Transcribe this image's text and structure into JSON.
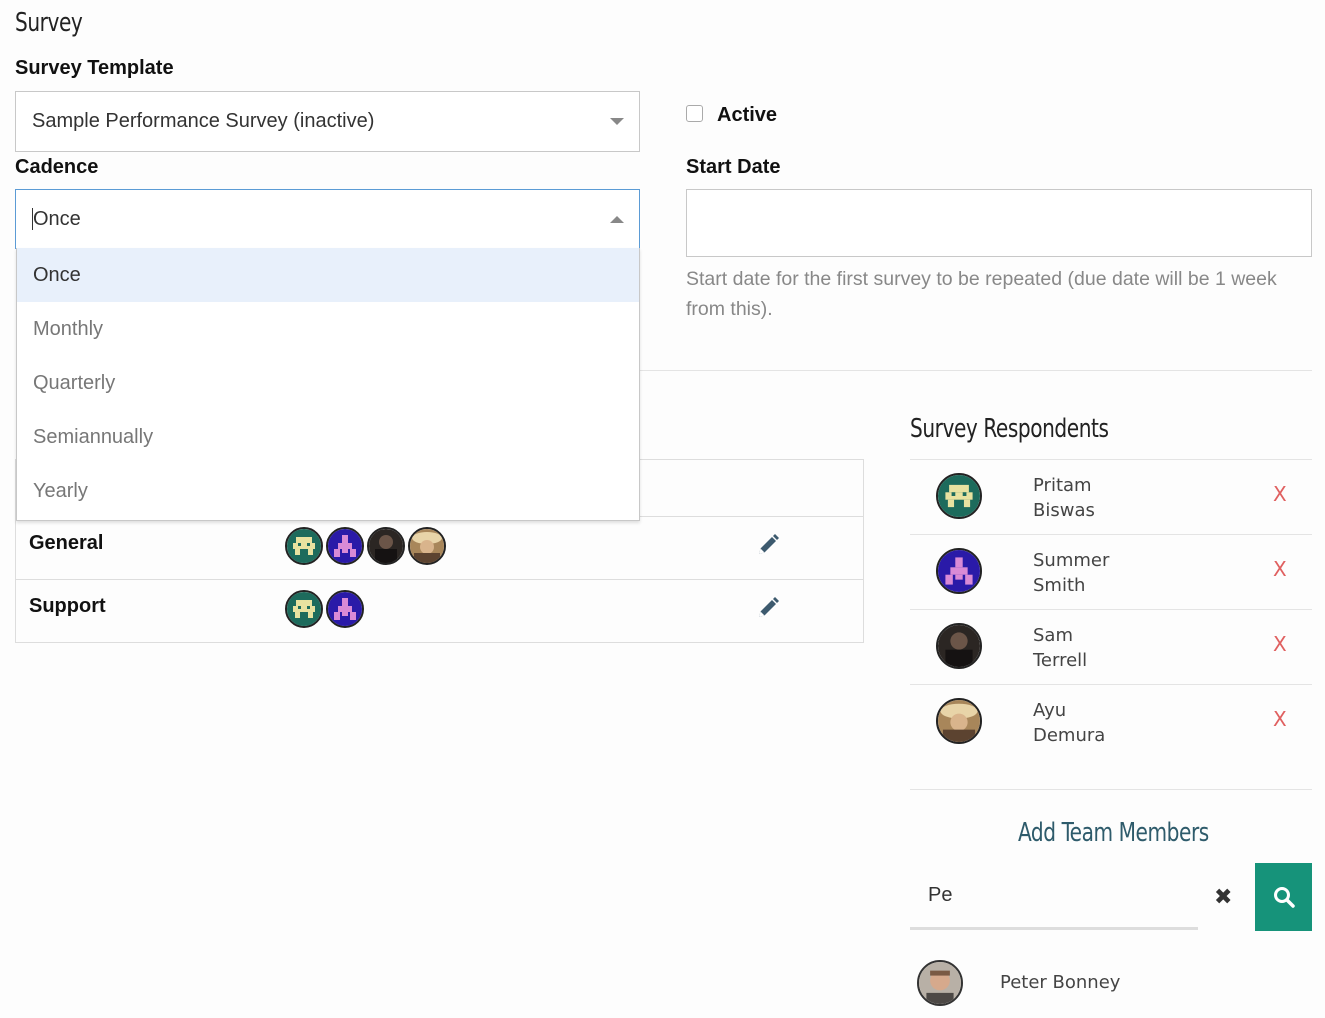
{
  "page": {
    "title": "Survey"
  },
  "survey_template": {
    "label": "Survey Template",
    "selected": "Sample Performance Survey (inactive)"
  },
  "active": {
    "label": "Active",
    "checked": false
  },
  "cadence": {
    "label": "Cadence",
    "selected": "Once",
    "options": [
      "Once",
      "Monthly",
      "Quarterly",
      "Semiannually",
      "Yearly"
    ]
  },
  "start_date": {
    "label": "Start Date",
    "value": "",
    "help": "Start date for the first survey to be repeated (due date will be 1 week from this)."
  },
  "teams": [
    {
      "name": "General",
      "avatars": [
        "pixel-teal",
        "pixel-purple",
        "photo-dark",
        "photo-tan"
      ]
    },
    {
      "name": "Support",
      "avatars": [
        "pixel-teal",
        "pixel-purple"
      ]
    }
  ],
  "respondents": {
    "title": "Survey Respondents",
    "items": [
      {
        "first": "Pritam",
        "last": "Biswas",
        "avatar": "pixel-teal",
        "remove": "X"
      },
      {
        "first": "Summer",
        "last": "Smith",
        "avatar": "pixel-purple",
        "remove": "X"
      },
      {
        "first": "Sam",
        "last": "Terrell",
        "avatar": "photo-dark",
        "remove": "X"
      },
      {
        "first": "Ayu",
        "last": "Demura",
        "avatar": "photo-tan",
        "remove": "X"
      }
    ]
  },
  "add_members": {
    "title": "Add Team Members",
    "query": "Pe",
    "clear_icon": "✖",
    "results": [
      {
        "name": "Peter Bonney",
        "avatar": "photo-peter"
      }
    ]
  },
  "colors": {
    "accent": "#16937a",
    "heading_teal": "#2e5b6b",
    "remove": "#e06060"
  }
}
